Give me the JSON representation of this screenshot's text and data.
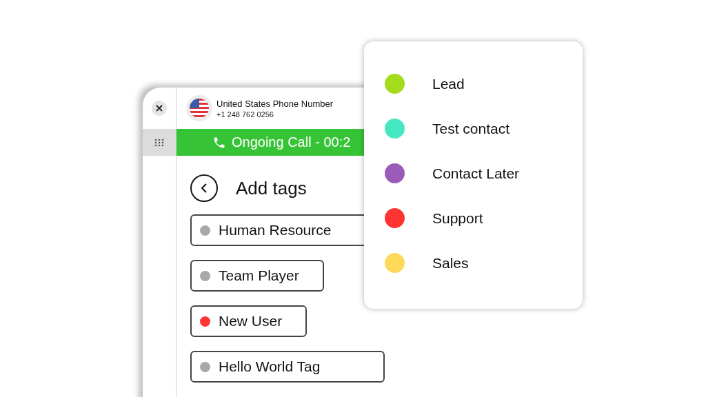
{
  "header": {
    "title": "United States Phone Number",
    "number": "+1 248 762 0256"
  },
  "call_bar": {
    "text": "Ongoing Call - 00:2"
  },
  "page": {
    "title": "Add tags"
  },
  "tags": [
    {
      "label": "Human Resource",
      "color": "#a8a8a8"
    },
    {
      "label": "Team Player",
      "color": "#a8a8a8"
    },
    {
      "label": "New User",
      "color": "#ff3535"
    },
    {
      "label": "Hello World Tag",
      "color": "#a8a8a8"
    }
  ],
  "popup": {
    "tags": [
      {
        "label": "Lead",
        "color": "#a6dc1e"
      },
      {
        "label": "Test contact",
        "color": "#45e8c0"
      },
      {
        "label": "Contact Later",
        "color": "#9a5cb8"
      },
      {
        "label": "Support",
        "color": "#ff3535"
      },
      {
        "label": "Sales",
        "color": "#ffd95a"
      }
    ]
  }
}
